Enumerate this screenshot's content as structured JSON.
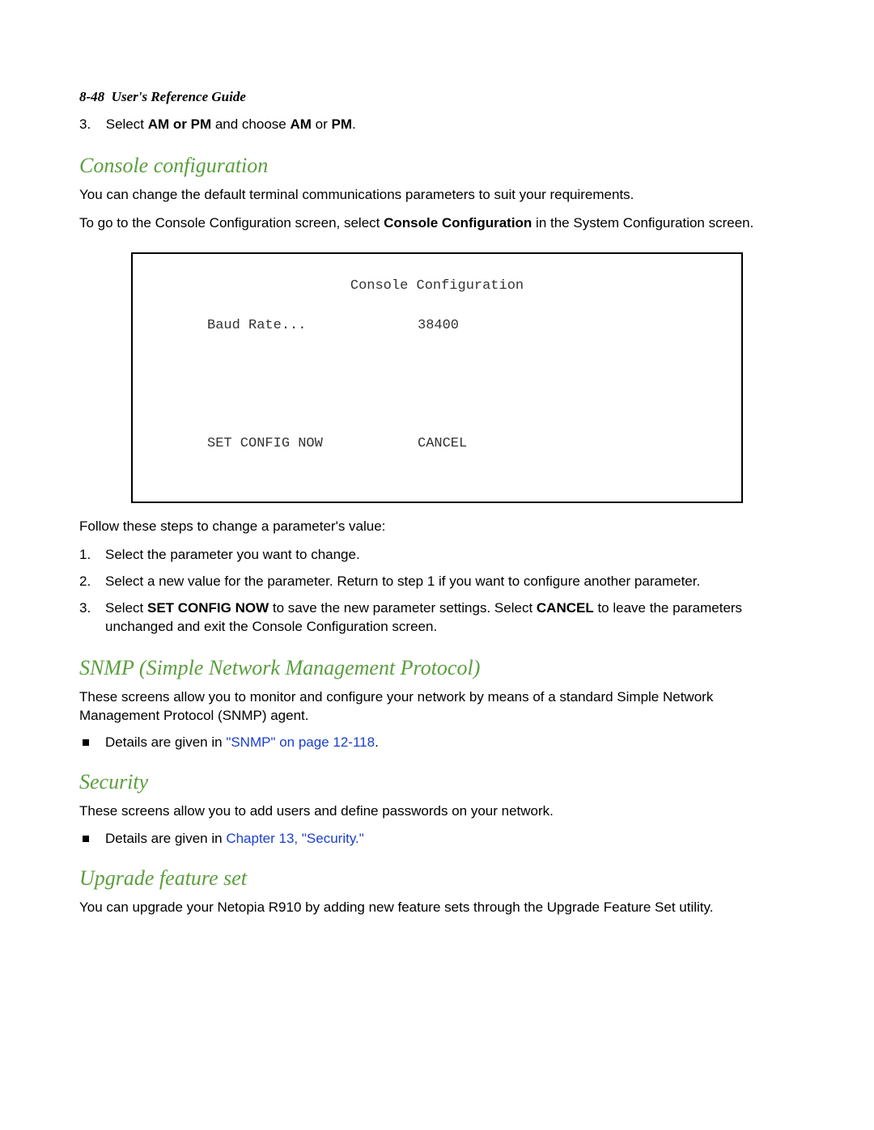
{
  "header": {
    "page_ref": "8-48",
    "guide_title": "User's Reference Guide"
  },
  "intro_step3": {
    "number": "3.",
    "prefix": "Select ",
    "bold1": "AM or PM",
    "mid": " and choose ",
    "bold2": "AM",
    "or": " or ",
    "bold3": "PM",
    "end": "."
  },
  "sections": {
    "console": {
      "heading": "Console configuration",
      "para1": "You can change the default terminal communications parameters to suit your requirements.",
      "para2_pre": "To go to the Console Configuration screen, select ",
      "para2_bold": "Console Configuration",
      "para2_post": " in the System Configuration screen.",
      "terminal": {
        "title": "Console Configuration",
        "baud_label": "Baud Rate...",
        "baud_value": "38400",
        "set_config": "SET CONFIG NOW",
        "cancel": "CANCEL"
      },
      "follow_intro": "Follow these steps to change a parameter's value:",
      "steps": [
        {
          "num": "1.",
          "text": "Select the parameter you want to change."
        },
        {
          "num": "2.",
          "text": "Select a new value for the parameter. Return to step 1 if you want to configure another parameter."
        }
      ],
      "step3b": {
        "num": "3.",
        "pre": "Select ",
        "b1": "SET CONFIG NOW",
        "mid": " to save the new parameter settings. Select ",
        "b2": "CANCEL",
        "post": " to leave the parameters unchanged and exit the Console Configuration screen."
      }
    },
    "snmp": {
      "heading": "SNMP (Simple Network Management Protocol)",
      "para": "These screens allow you to monitor and configure your network by means of a standard Simple Network Management Protocol (SNMP) agent.",
      "bullet_pre": "Details are given in ",
      "bullet_link": "\"SNMP\" on page 12-118",
      "bullet_post": "."
    },
    "security": {
      "heading": "Security",
      "para": "These screens allow you to add users and define passwords on your network.",
      "bullet_pre": "Details are given in ",
      "bullet_link": "Chapter 13, \"Security.\""
    },
    "upgrade": {
      "heading": "Upgrade feature set",
      "para": "You can upgrade your Netopia R910 by adding new feature sets through the Upgrade Feature Set utility."
    }
  }
}
